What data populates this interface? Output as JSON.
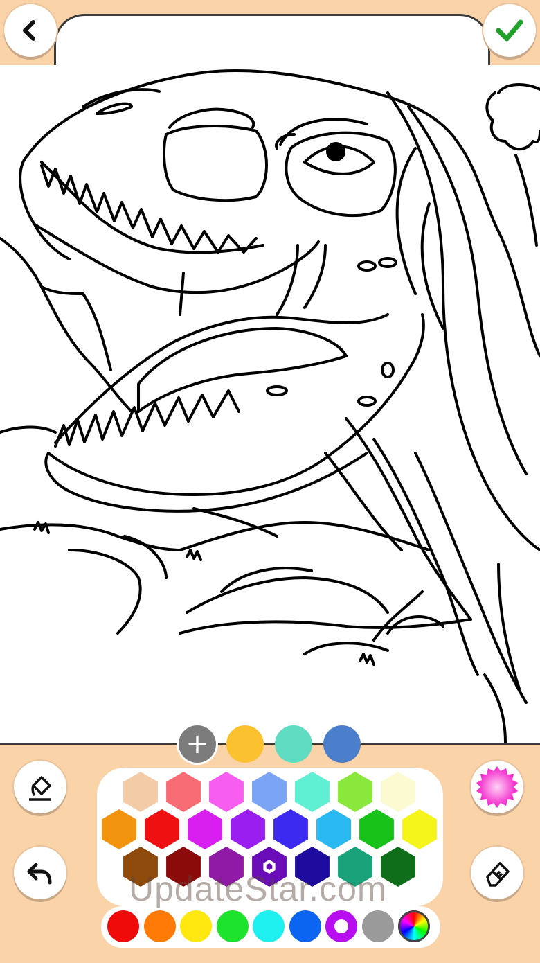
{
  "header": {
    "back_icon": "chevron-left-icon",
    "done_icon": "check-icon",
    "done_color": "#1fa12b"
  },
  "toolbar": {
    "bucket_icon": "paint-bucket-icon",
    "undo_icon": "undo-icon",
    "texture_icon": "pattern-gear-icon",
    "eraser_icon": "eraser-icon",
    "add_label": "+"
  },
  "recent_colors": [
    "#fcc12f",
    "#5fdcc2",
    "#4c7fcb"
  ],
  "palette": [
    [
      "#f3cca7",
      "#f76b75",
      "#f75ef0",
      "#7ba5f4",
      "#5ff0d4",
      "#8ae83c",
      "#fcfad0"
    ],
    [
      "#f3940f",
      "#ef1111",
      "#d81ff0",
      "#9b1ef0",
      "#3d2af0",
      "#2ab9f0",
      "#19c219",
      "#f5f51c"
    ],
    [
      "#8e4b0b",
      "#8b0b0b",
      "#8e1aa6",
      "#6a0cb8",
      "#1d0c9e",
      "#1aa37a",
      "#0e6e1a"
    ]
  ],
  "selected_palette_color": "#6a0cb8",
  "basic_colors": [
    "#f00b0b",
    "#ff7a07",
    "#ffe710",
    "#1ee32c",
    "#1ef0f0",
    "#0c65f0",
    "#b70ef0",
    "#9a9a9a",
    "rainbow"
  ],
  "selected_basic_color": "#b70ef0",
  "watermark": "UpdateStar.com"
}
